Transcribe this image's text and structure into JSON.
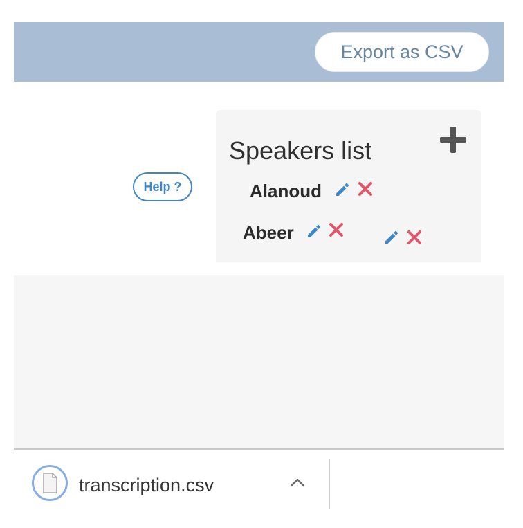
{
  "toolbar": {
    "export_label": "Export as CSV"
  },
  "help": {
    "label": "Help ?"
  },
  "speakers": {
    "title": "Speakers list",
    "items": [
      {
        "name": "Alanoud"
      },
      {
        "name": "Abeer"
      }
    ]
  },
  "download": {
    "filename": "transcription.csv"
  },
  "icons": {
    "add": "plus-icon",
    "edit": "pencil-icon",
    "delete": "close-icon",
    "file": "file-icon",
    "chevron": "chevron-up-icon"
  },
  "colors": {
    "header_bg": "#a9bdd5",
    "accent_blue": "#3d86c7",
    "delete_red": "#e0576b",
    "panel_bg": "#f5f5f5",
    "export_text": "#6585a3"
  }
}
